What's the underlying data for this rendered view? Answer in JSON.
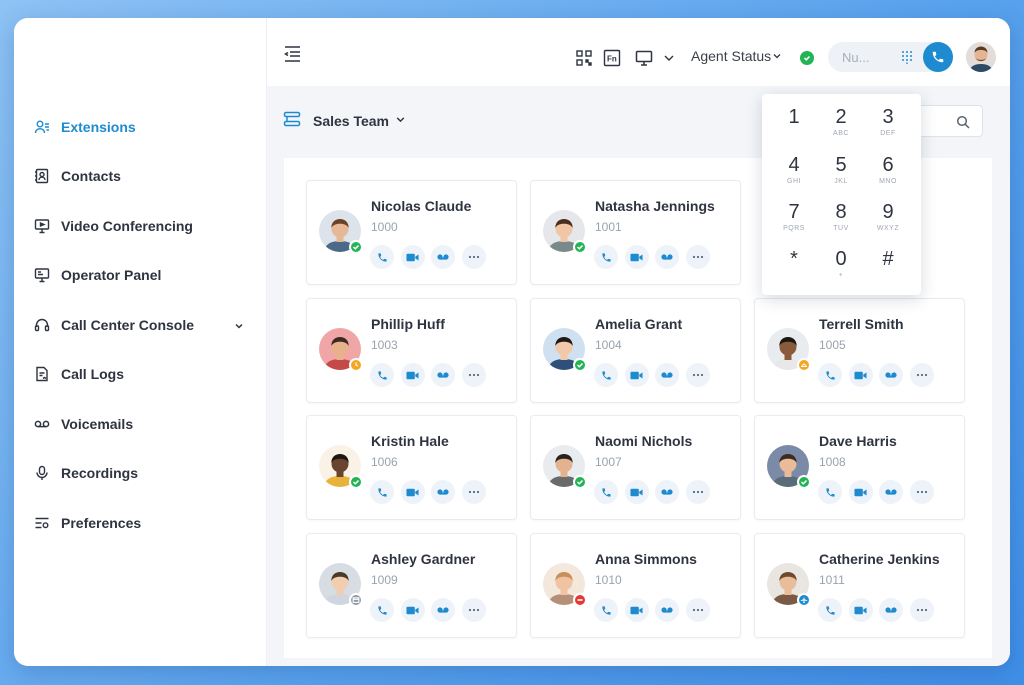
{
  "sidebar": {
    "items": [
      {
        "label": "Extensions",
        "icon": "users-icon",
        "active": true
      },
      {
        "label": "Contacts",
        "icon": "contacts-book-icon"
      },
      {
        "label": "Video Conferencing",
        "icon": "monitor-video-icon"
      },
      {
        "label": "Operator Panel",
        "icon": "operator-panel-icon"
      },
      {
        "label": "Call Center Console",
        "icon": "headset-icon",
        "has_submenu": true
      },
      {
        "label": "Call Logs",
        "icon": "call-logs-icon"
      },
      {
        "label": "Voicemails",
        "icon": "voicemail-icon"
      },
      {
        "label": "Recordings",
        "icon": "microphone-icon"
      },
      {
        "label": "Preferences",
        "icon": "preferences-icon"
      }
    ]
  },
  "topbar": {
    "agent_status": "Agent Status",
    "dial_placeholder": "Nu...",
    "status_color": "#22b455"
  },
  "main": {
    "team": "Sales Team",
    "extensions": [
      {
        "name": "Nicolas Claude",
        "ext": "1000",
        "status": "available"
      },
      {
        "name": "Natasha Jennings",
        "ext": "1001",
        "status": "available"
      },
      {
        "name": "Phillip Huff",
        "ext": "1003",
        "status": "away"
      },
      {
        "name": "Amelia Grant",
        "ext": "1004",
        "status": "available"
      },
      {
        "name": "Terrell Smith",
        "ext": "1005",
        "status": "lunch"
      },
      {
        "name": "Kristin Hale",
        "ext": "1006",
        "status": "available"
      },
      {
        "name": "Naomi Nichols",
        "ext": "1007",
        "status": "available"
      },
      {
        "name": "Dave Harris",
        "ext": "1008",
        "status": "available"
      },
      {
        "name": "Ashley Gardner",
        "ext": "1009",
        "status": "meeting"
      },
      {
        "name": "Anna Simmons",
        "ext": "1010",
        "status": "busy"
      },
      {
        "name": "Catherine Jenkins",
        "ext": "1011",
        "status": "travel"
      }
    ]
  },
  "keypad": {
    "keys": [
      {
        "digit": "1",
        "letters": ""
      },
      {
        "digit": "2",
        "letters": "ABC"
      },
      {
        "digit": "3",
        "letters": "DEF"
      },
      {
        "digit": "4",
        "letters": "GHI"
      },
      {
        "digit": "5",
        "letters": "JKL"
      },
      {
        "digit": "6",
        "letters": "MNO"
      },
      {
        "digit": "7",
        "letters": "PQRS"
      },
      {
        "digit": "8",
        "letters": "TUV"
      },
      {
        "digit": "9",
        "letters": "WXYZ"
      },
      {
        "digit": "*",
        "letters": ""
      },
      {
        "digit": "0",
        "letters": "+"
      },
      {
        "digit": "#",
        "letters": ""
      }
    ]
  },
  "colors": {
    "accent": "#1e8bd0",
    "available": "#22b455",
    "away": "#f5a623",
    "busy": "#e53935",
    "neutral": "#8e99a5"
  }
}
